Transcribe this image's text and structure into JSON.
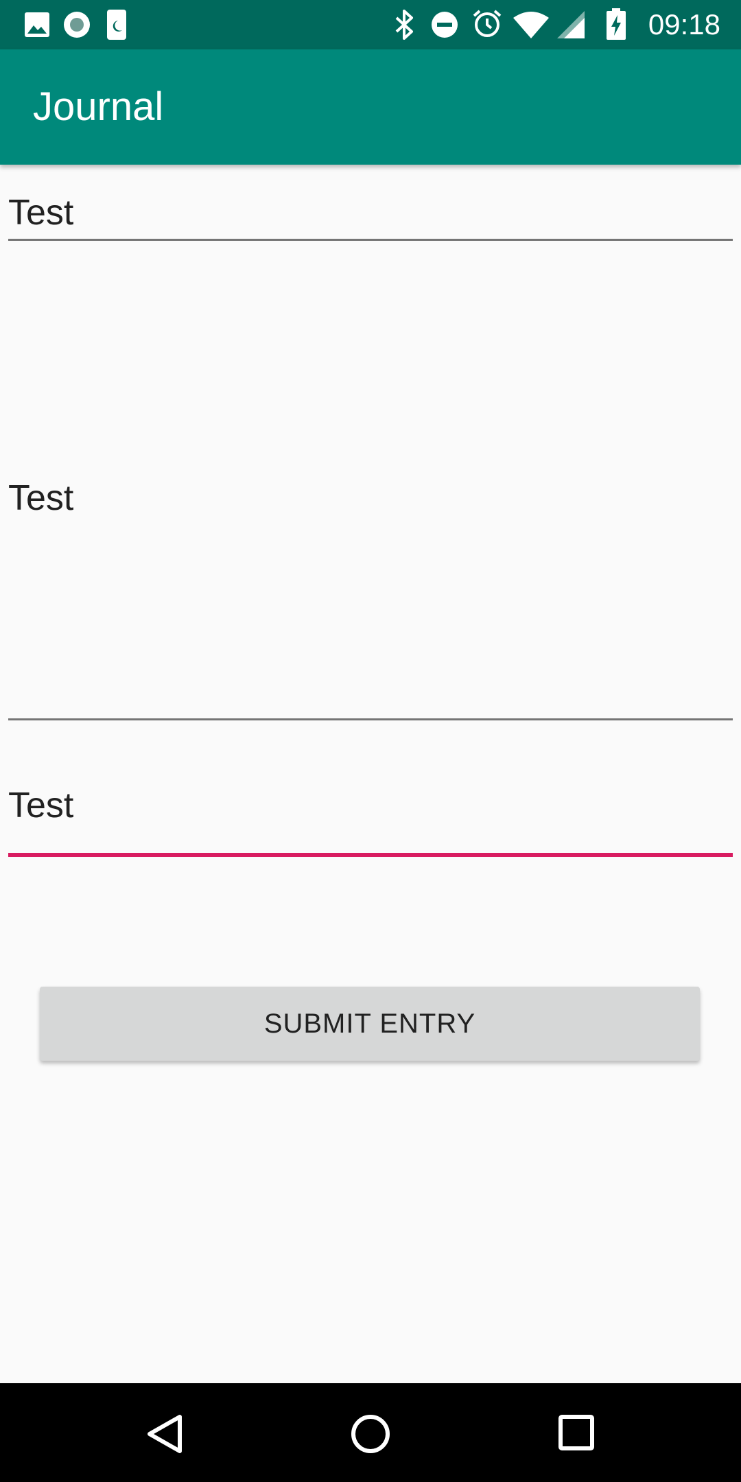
{
  "status_bar": {
    "time": "09:18",
    "left_icons": [
      "image-icon",
      "record-icon",
      "moon-icon"
    ],
    "right_icons": [
      "bluetooth-icon",
      "do-not-disturb-icon",
      "alarm-icon",
      "wifi-icon",
      "cell-signal-icon",
      "battery-charging-icon"
    ]
  },
  "app_bar": {
    "title": "Journal",
    "color": "#00897b"
  },
  "form": {
    "title_field_value": "Test",
    "body_field_value": "Test",
    "tag_field_value": "Test",
    "focused_underline_color": "#d81b60",
    "submit_label": "SUBMIT ENTRY"
  },
  "nav_bar": {
    "buttons": [
      "back-icon",
      "home-icon",
      "recents-icon"
    ]
  }
}
